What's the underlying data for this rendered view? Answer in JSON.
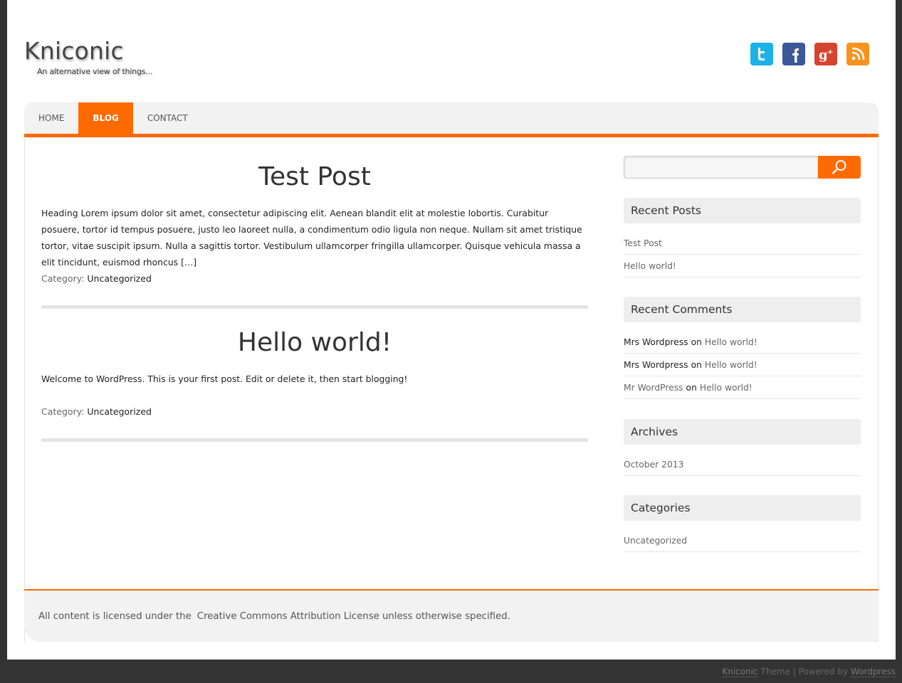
{
  "header": {
    "title": "Kniconic",
    "tagline": "An alternative view of things..."
  },
  "social": [
    {
      "name": "twitter",
      "icon": "twitter-icon",
      "color": "#1ab2e8"
    },
    {
      "name": "facebook",
      "icon": "facebook-icon",
      "color": "#3b5998"
    },
    {
      "name": "google-plus",
      "icon": "google-plus-icon",
      "color": "#d6442f"
    },
    {
      "name": "rss",
      "icon": "rss-icon",
      "color": "#f7931e"
    }
  ],
  "nav": {
    "items": [
      {
        "label": "HOME",
        "active": false
      },
      {
        "label": "BLOG",
        "active": true
      },
      {
        "label": "CONTACT",
        "active": false
      }
    ]
  },
  "posts": [
    {
      "title": "Test Post",
      "excerpt": "Heading Lorem ipsum dolor sit amet, consectetur adipiscing elit. Aenean blandit elit at molestie lobortis. Curabitur posuere, tortor id tempus posuere, justo leo laoreet nulla, a condimentum odio ligula non neque. Nullam sit amet tristique tortor, vitae suscipit ipsum. Nulla a sagittis tortor. Vestibulum ullamcorper fringilla ullamcorper. Quisque vehicula massa a elit tincidunt, euismod rhoncus […]",
      "category_label": "Category:",
      "category": "Uncategorized"
    },
    {
      "title": "Hello world!",
      "excerpt": "Welcome to WordPress. This is your first post. Edit or delete it, then start blogging!",
      "category_label": "Category:",
      "category": "Uncategorized"
    }
  ],
  "sidebar": {
    "search": {
      "placeholder": "",
      "value": "",
      "icon": "search-icon"
    },
    "recent_posts": {
      "title": "Recent Posts",
      "items": [
        "Test Post",
        "Hello world!"
      ]
    },
    "recent_comments": {
      "title": "Recent Comments",
      "items": [
        {
          "author": "Mrs Wordpress",
          "on": "on",
          "post": "Hello world!"
        },
        {
          "author": "Mrs Wordpress",
          "on": "on",
          "post": "Hello world!"
        },
        {
          "author": "Mr WordPress",
          "on": "on",
          "post": "Hello world!"
        }
      ]
    },
    "archives": {
      "title": "Archives",
      "items": [
        "October 2013"
      ]
    },
    "categories": {
      "title": "Categories",
      "items": [
        "Uncategorized"
      ]
    }
  },
  "footer": {
    "license_prefix": "All content is licensed under the",
    "license_link": "Creative Commons Attribution License",
    "license_suffix": "unless otherwise specified."
  },
  "credits": {
    "theme_link": "Kniconic",
    "theme_text": "Theme",
    "separator": "|",
    "powered_text": "Powered by",
    "powered_link": "Wordpress"
  },
  "colors": {
    "accent": "#ff6a00",
    "background": "#333333"
  }
}
